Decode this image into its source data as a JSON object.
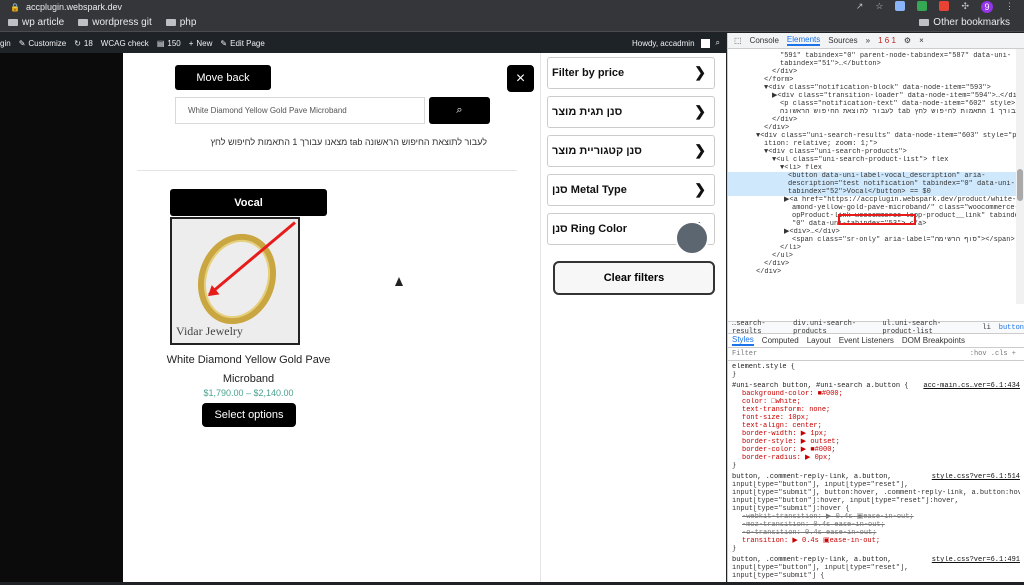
{
  "browser": {
    "url": "accplugin.webspark.dev",
    "bookmarks": [
      "wp article",
      "wordpress git",
      "php"
    ],
    "other_bookmarks": "Other bookmarks",
    "profile_badge": "9"
  },
  "admin_bar": {
    "items": [
      "gin",
      "Customize",
      "18",
      "WCAG check",
      "150",
      "New",
      "Edit Page"
    ],
    "greeting": "Howdy, accadmin"
  },
  "search": {
    "move_back": "Move back",
    "close": "×",
    "input_value": "White Diamond Yellow Gold Pave Microband",
    "hint": "לעבור לתוצאת החיפוש הראשונה tab מצאנו עבורך 1 התאמות לחיפוש לחץ"
  },
  "product": {
    "vocal_label": "Vocal",
    "watermark": "Vidar Jewelry",
    "title": "White Diamond Yellow Gold Pave Microband",
    "price": "$1,790.00 – $2,140.00",
    "select_label": "Select options"
  },
  "filters": {
    "items": [
      "Filter by price",
      "סנן תגית מוצר",
      "סנן קטגוריית מוצר",
      "סנן Metal Type",
      "סנן Ring Color"
    ],
    "clear_label": "Clear filters"
  },
  "devtools": {
    "tabs": [
      "Console",
      "Elements",
      "Sources"
    ],
    "active_tab": "Elements",
    "status": "1  6  1",
    "dom_lines": [
      "\"591\" tabindex=\"0\" parent-node-tabindex=\"587\" data-uni-",
      "tabindex=\"51\">…</button>",
      "</div>",
      "</form>",
      "▼<div class=\"notification-block\" data-node-item=\"593\">",
      "▶<div class=\"transition-loader\" data-node-item=\"594\">…</div>",
      "<p class=\"notification-text\" data-node-item=\"602\" style>מצאנו",
      "לעבור לתוצאת החיפוש הראשונה tab עבורך 1 התאמות לחיפוש לחץ</p>",
      "</div>",
      "</div>",
      "▼<div class=\"uni-search-results\" data-node-item=\"603\" style=\"pos",
      "ition: relative; zoom: 1;\">",
      "▼<div class=\"uni-search-products\">",
      "▼<ul class=\"uni-search-product-list\"> flex",
      "▼<li> flex",
      "<button data-uni-label-vocal_description\" aria-",
      "description=\"test notification\" tabindex=\"0\" data-uni-",
      "tabindex=\"52\">Vocal</button> == $0",
      "▶<a href=\"https://accplugin.webspark.dev/product/white-di",
      "amond-yellow-gold-pave-microband/\" class=\"woocommerce-Lo",
      "opProduct-link woocommerce-loop-product__link\" tabindex=",
      "\"0\" data-uni-tabindex=\"53\">…</a>",
      "▶<div>…</div>",
      "<span class=\"sr-only\" aria-label=\"סוף הרשימה\"></span>",
      "</li>",
      "</ul>",
      "</div>",
      "</div>"
    ],
    "breadcrumbs": [
      "…search-results",
      "div.uni-search-products",
      "ul.uni-search-product-list",
      "li",
      "button"
    ],
    "style_tabs": [
      "Styles",
      "Computed",
      "Layout",
      "Event Listeners",
      "DOM Breakpoints"
    ],
    "filter_placeholder": "Filter",
    "filter_right": ":hov  .cls  +",
    "element_style": "element.style {",
    "rules": [
      {
        "selector": "#uni-search button, #uni-search a.button {",
        "source": "acc-main.cs…ver=6.1:434",
        "props": [
          "background-color: ■#000;",
          "color: □white;",
          "text-transform: none;",
          "font-size: 10px;",
          "text-align: center;",
          "border-width: ▶ 1px;",
          "border-style: ▶ outset;",
          "border-color: ▶ ■#000;",
          "border-radius: ▶ 0px;"
        ]
      },
      {
        "selector": "button, .comment-reply-link, a.button,",
        "source": "style.css?ver=6.1:514",
        "props": [
          "input[type=\"button\"], input[type=\"reset\"],",
          "input[type=\"submit\"], button:hover, .comment-reply-link, a.button:hover,",
          "input[type=\"button\"]:hover, input[type=\"reset\"]:hover,",
          "input[type=\"submit\"]:hover {",
          "-webkit-transition: ▶ 0.4s ▣ease-in-out;",
          "-moz-transition: 0.4s ease-in-out;",
          "-o-transition: 0.4s ease-in-out;",
          "transition: ▶ 0.4s ▣ease-in-out;"
        ]
      },
      {
        "selector": "button, .comment-reply-link, a.button,",
        "source": "style.css?ver=6.1:491",
        "props": [
          "input[type=\"button\"], input[type=\"reset\"],",
          "input[type=\"submit\"] {"
        ]
      }
    ]
  }
}
